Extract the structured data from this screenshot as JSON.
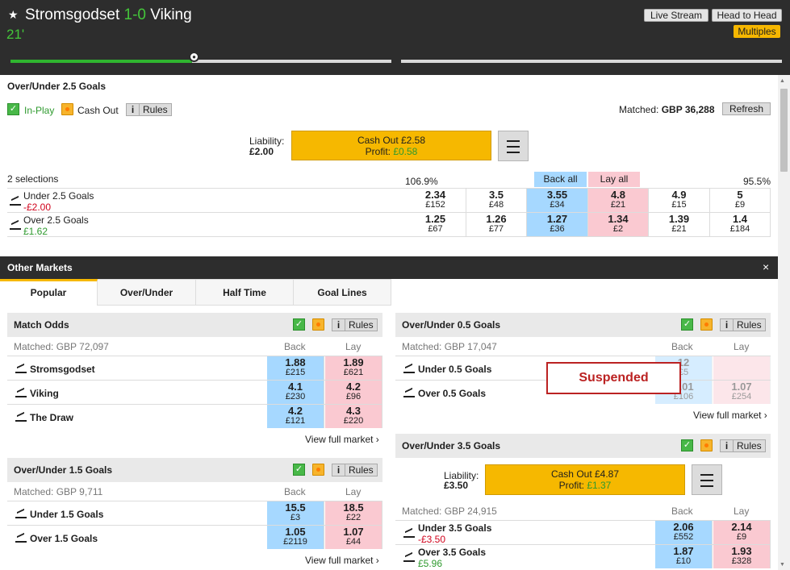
{
  "event": {
    "home": "Stromsgodset",
    "score": "1-0",
    "away": "Viking",
    "clock": "21'"
  },
  "header_buttons": {
    "live_stream": "Live Stream",
    "head_to_head": "Head to Head",
    "multiples": "Multiples"
  },
  "main_market": {
    "title": "Over/Under 2.5 Goals",
    "inplay": "In-Play",
    "cashout": "Cash Out",
    "rules_i": "i",
    "rules": "Rules",
    "matched_label": "Matched:",
    "matched_value": "GBP 36,288",
    "refresh": "Refresh",
    "liability_label": "Liability:",
    "liability_value": "£2.00",
    "cashout_button": "Cash Out £2.58",
    "profit_label": "Profit:",
    "profit_value": "£0.58",
    "selections_count": "2 selections",
    "back_pct": "106.9%",
    "lay_pct": "95.5%",
    "back_all": "Back all",
    "lay_all": "Lay all",
    "runners": [
      {
        "name": "Under 2.5 Goals",
        "pl": "-£2.00",
        "prices": [
          [
            "2.34",
            "£152"
          ],
          [
            "3.5",
            "£48"
          ],
          [
            "3.55",
            "£34"
          ],
          [
            "4.8",
            "£21"
          ],
          [
            "4.9",
            "£15"
          ],
          [
            "5",
            "£9"
          ]
        ]
      },
      {
        "name": "Over 2.5 Goals",
        "pl": "£1.62",
        "prices": [
          [
            "1.25",
            "£67"
          ],
          [
            "1.26",
            "£77"
          ],
          [
            "1.27",
            "£36"
          ],
          [
            "1.34",
            "£2"
          ],
          [
            "1.39",
            "£21"
          ],
          [
            "1.4",
            "£184"
          ]
        ]
      }
    ]
  },
  "other_markets": {
    "title": "Other Markets",
    "close": "×",
    "tabs": [
      "Popular",
      "Over/Under",
      "Half Time",
      "Goal Lines"
    ]
  },
  "match_odds": {
    "title": "Match Odds",
    "matched": "Matched: GBP 72,097",
    "back": "Back",
    "lay": "Lay",
    "rules_i": "i",
    "rules": "Rules",
    "runners": [
      {
        "name": "Stromsgodset",
        "back": "1.88",
        "back_s": "£215",
        "lay": "1.89",
        "lay_s": "£621"
      },
      {
        "name": "Viking",
        "back": "4.1",
        "back_s": "£230",
        "lay": "4.2",
        "lay_s": "£96"
      },
      {
        "name": "The Draw",
        "back": "4.2",
        "back_s": "£121",
        "lay": "4.3",
        "lay_s": "£220"
      }
    ],
    "view_full": "View full market ›"
  },
  "ou15": {
    "title": "Over/Under 1.5 Goals",
    "matched": "Matched: GBP 9,711",
    "back": "Back",
    "lay": "Lay",
    "rules_i": "i",
    "rules": "Rules",
    "runners": [
      {
        "name": "Under 1.5 Goals",
        "back": "15.5",
        "back_s": "£3",
        "lay": "18.5",
        "lay_s": "£22"
      },
      {
        "name": "Over 1.5 Goals",
        "back": "1.05",
        "back_s": "£2119",
        "lay": "1.07",
        "lay_s": "£44"
      }
    ],
    "view_full": "View full market ›"
  },
  "ou05": {
    "title": "Over/Under 0.5 Goals",
    "matched": "Matched: GBP 17,047",
    "back": "Back",
    "lay": "Lay",
    "rules_i": "i",
    "rules": "Rules",
    "runners": [
      {
        "name": "Under 0.5 Goals",
        "back": "12",
        "back_s": "£5",
        "lay": "",
        "lay_s": ""
      },
      {
        "name": "Over 0.5 Goals",
        "back": "1.01",
        "back_s": "£106",
        "lay": "1.07",
        "lay_s": "£254"
      }
    ],
    "suspended": "Suspended",
    "view_full": "View full market ›"
  },
  "ou35": {
    "title": "Over/Under 3.5 Goals",
    "matched": "Matched: GBP 24,915",
    "back": "Back",
    "lay": "Lay",
    "rules_i": "i",
    "rules": "Rules",
    "liability_label": "Liability:",
    "liability_value": "£3.50",
    "cashout_button": "Cash Out £4.87",
    "profit_label": "Profit:",
    "profit_value": "£1.37",
    "runners": [
      {
        "name": "Under 3.5 Goals",
        "pl": "-£3.50",
        "back": "2.06",
        "back_s": "£552",
        "lay": "2.14",
        "lay_s": "£9"
      },
      {
        "name": "Over 3.5 Goals",
        "pl": "£5.96",
        "back": "1.87",
        "back_s": "£10",
        "lay": "1.93",
        "lay_s": "£328"
      }
    ]
  }
}
